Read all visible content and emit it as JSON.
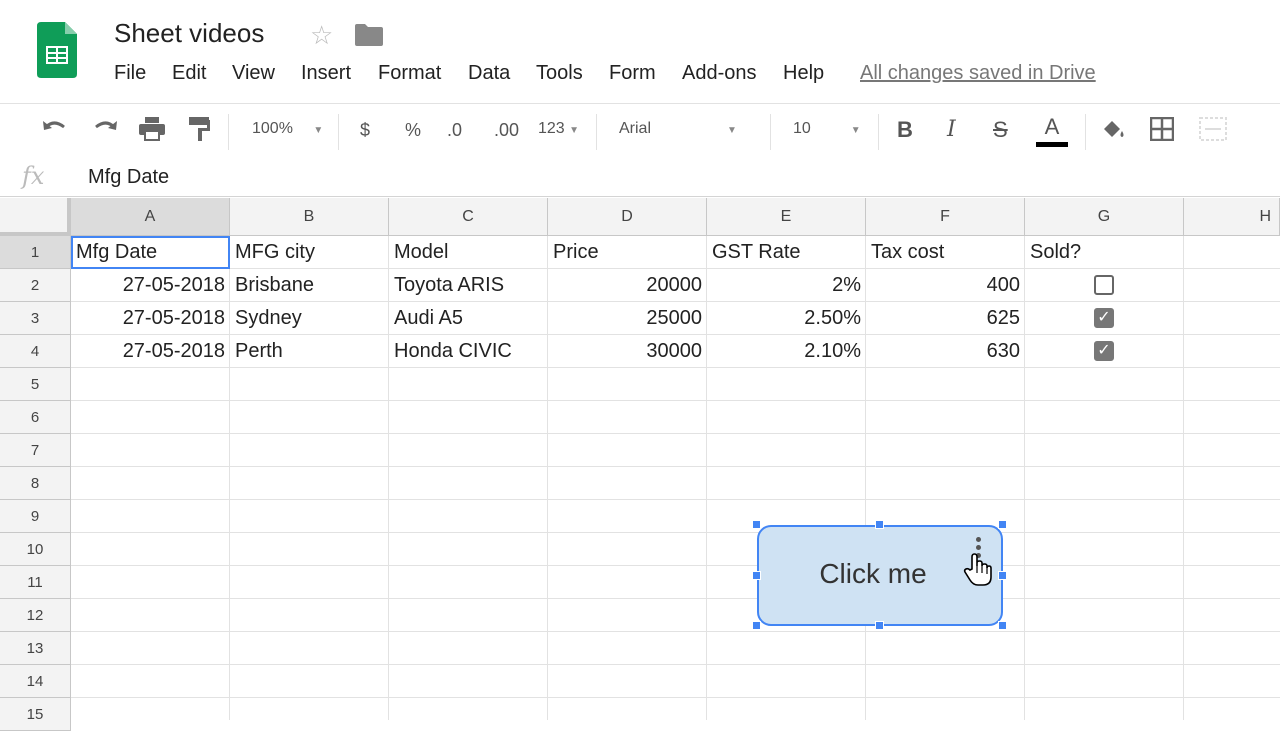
{
  "doc": {
    "title": "Sheet videos",
    "saved_status": "All changes saved in Drive"
  },
  "menu": [
    "File",
    "Edit",
    "View",
    "Insert",
    "Format",
    "Data",
    "Tools",
    "Form",
    "Add-ons",
    "Help"
  ],
  "toolbar": {
    "zoom": "100%",
    "currency": "$",
    "percent": "%",
    "decrease_decimal": ".0",
    "increase_decimal": ".00",
    "more_formats": "123",
    "font": "Arial",
    "font_size": "10",
    "bold": "B",
    "italic": "I",
    "strikethrough": "S",
    "text_color": "A",
    "text_color_value": "#000000"
  },
  "formula_bar": {
    "fx": "fx",
    "value": "Mfg Date"
  },
  "columns": [
    "A",
    "B",
    "C",
    "D",
    "E",
    "F",
    "G",
    "H"
  ],
  "rows": [
    "1",
    "2",
    "3",
    "4",
    "5",
    "6",
    "7",
    "8",
    "9",
    "10",
    "11",
    "12",
    "13",
    "14",
    "15"
  ],
  "cells": {
    "header": [
      "Mfg Date",
      "MFG city",
      "Model",
      "Price",
      "GST Rate",
      "Tax cost",
      "Sold?"
    ],
    "data": [
      {
        "mfg_date": "27-05-2018",
        "city": "Brisbane",
        "model": "Toyota ARIS",
        "price": "20000",
        "gst": "2%",
        "tax": "400",
        "sold": false
      },
      {
        "mfg_date": "27-05-2018",
        "city": "Sydney",
        "model": "Audi A5",
        "price": "25000",
        "gst": "2.50%",
        "tax": "625",
        "sold": true
      },
      {
        "mfg_date": "27-05-2018",
        "city": "Perth",
        "model": "Honda CIVIC",
        "price": "30000",
        "gst": "2.10%",
        "tax": "630",
        "sold": true
      }
    ]
  },
  "drawing": {
    "label": "Click me",
    "fill": "#cfe2f3",
    "border": "#4285f4"
  },
  "colors": {
    "accent": "#4285f4",
    "logo_green": "#0f9d58"
  }
}
